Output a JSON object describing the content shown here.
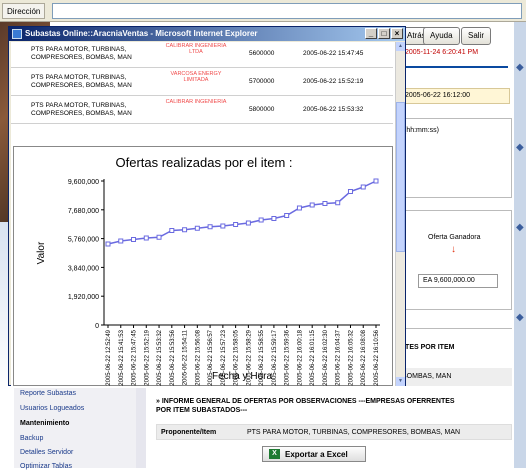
{
  "browser": {
    "address_label": "Dirección",
    "buttons": [
      "Atrás",
      "Ayuda",
      "Salir"
    ],
    "date_top": "2005-11-24 6:20:41 PM",
    "date_box": "2005-06-22 16:12:00",
    "time_hint": "(hh:mm:ss)",
    "winning_offer_label": "Oferta Ganadora",
    "winning_amount": "EA 9,600,000.00",
    "section_fragment": "RTES POR ITEM",
    "items_fragment": "BOMBAS, MAN"
  },
  "menu": {
    "items": [
      {
        "label": "Reporte Subastas"
      },
      {
        "label": "Usuarios Logueados"
      },
      {
        "label": "Mantenimiento",
        "header": true
      },
      {
        "label": "Backup"
      },
      {
        "label": "Detalles Servidor"
      },
      {
        "label": "Optimizar Tablas"
      }
    ]
  },
  "report": {
    "heading": "» INFORME GENERAL DE OFERTAS POR OBSERVACIONES ---EMPRESAS OFERRENTES POR ITEM SUBASTADOS---",
    "proponent_label": "Proponente/Item",
    "proponent_value": "PTS PARA MOTOR, TURBINAS, COMPRESORES, BOMBAS, MAN",
    "export_label": "Exportar a Excel"
  },
  "popup": {
    "title": "Subastas Online::AracniaVentas - Microsoft Internet Explorer",
    "controls": {
      "minimize": "_",
      "maximize": "□",
      "close": "×"
    },
    "bids": [
      {
        "item": "PTS PARA MOTOR, TURBINAS, COMPRESORES, BOMBAS, MAN",
        "bidder": "CALIBRAR INGENIERIA LTDA",
        "amount": "5600000",
        "date": "2005-06-22 15:47:45"
      },
      {
        "item": "PTS PARA MOTOR, TURBINAS, COMPRESORES, BOMBAS, MAN",
        "bidder": "VARCOSA ENERGY LIMITADA",
        "amount": "5700000",
        "date": "2005-06-22 15:52:19"
      },
      {
        "item": "PTS PARA MOTOR, TURBINAS, COMPRESORES, BOMBAS, MAN",
        "bidder": "CALIBRAR INGENIERIA",
        "amount": "5800000",
        "date": "2005-06-22 15:53:32"
      }
    ]
  },
  "chart_data": {
    "type": "line",
    "title": "Ofertas realizadas por el item :",
    "xlabel": "Fecha y Hora",
    "ylabel": "Valor",
    "ylim": [
      0,
      9600000
    ],
    "yticks": [
      "9,600,000",
      "7,680,000",
      "5,760,000",
      "3,840,000",
      "1,920,000",
      "0"
    ],
    "grid": false,
    "line_color": "#6a6ae0",
    "x": [
      "2005-06-22 12:52:49",
      "2005-06-22 15:41:53",
      "2005-06-22 15:47:45",
      "2005-06-22 15:52:19",
      "2005-06-22 15:53:32",
      "2005-06-22 15:53:56",
      "2005-06-22 15:54:11",
      "2005-06-22 15:56:08",
      "2005-06-22 15:56:57",
      "2005-06-22 15:57:23",
      "2005-06-22 15:58:05",
      "2005-06-22 15:58:29",
      "2005-06-22 15:58:55",
      "2005-06-22 15:59:17",
      "2005-06-22 15:59:36",
      "2005-06-22 16:00:18",
      "2005-06-22 16:01:15",
      "2005-06-22 16:02:30",
      "2005-06-22 16:04:37",
      "2005-06-22 16:05:32",
      "2005-06-22 16:08:08",
      "2005-06-22 16:10:56"
    ],
    "values": [
      5400000,
      5600000,
      5700000,
      5800000,
      5850000,
      6300000,
      6350000,
      6450000,
      6550000,
      6600000,
      6700000,
      6800000,
      7000000,
      7100000,
      7300000,
      7800000,
      8000000,
      8100000,
      8150000,
      8900000,
      9200000,
      9600000
    ]
  }
}
